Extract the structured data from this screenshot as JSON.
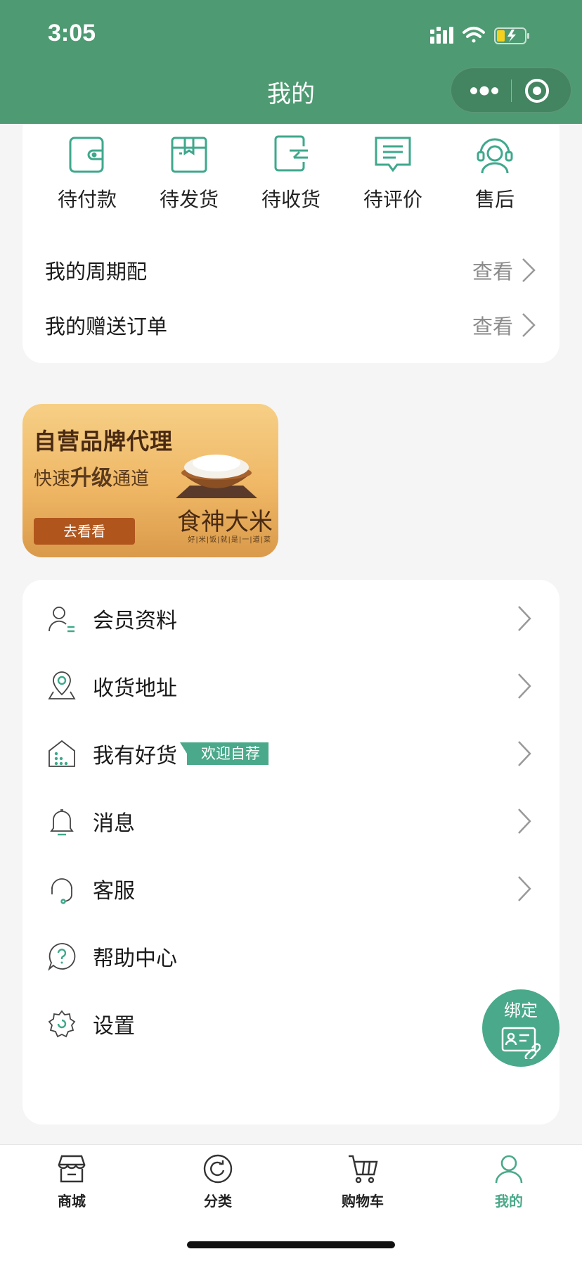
{
  "status_bar": {
    "time": "3:05"
  },
  "nav": {
    "title": "我的"
  },
  "orders": {
    "items": [
      {
        "label": "待付款",
        "icon": "wallet-icon"
      },
      {
        "label": "待发货",
        "icon": "box-icon"
      },
      {
        "label": "待收货",
        "icon": "receive-icon"
      },
      {
        "label": "待评价",
        "icon": "comment-icon"
      },
      {
        "label": "售后",
        "icon": "headset-icon"
      }
    ],
    "links": [
      {
        "title": "我的周期配",
        "action": "查看"
      },
      {
        "title": "我的赠送订单",
        "action": "查看"
      }
    ]
  },
  "banner": {
    "title": "自营品牌代理",
    "subtitle_pre": "快速",
    "subtitle_bold": "升级",
    "subtitle_post": "通道",
    "button": "去看看",
    "brand": "食神大米",
    "tiny": "好|米|饭|就|是|一|道|菜"
  },
  "menu": {
    "items": [
      {
        "label": "会员资料",
        "icon": "member-profile-icon"
      },
      {
        "label": "收货地址",
        "icon": "location-icon"
      },
      {
        "label": "我有好货",
        "icon": "house-icon",
        "tag": "欢迎自荐"
      },
      {
        "label": "消息",
        "icon": "bell-icon"
      },
      {
        "label": "客服",
        "icon": "customer-service-icon"
      },
      {
        "label": "帮助中心",
        "icon": "help-icon"
      },
      {
        "label": "设置",
        "icon": "settings-icon"
      }
    ]
  },
  "float_button": {
    "label": "绑定"
  },
  "tabbar": {
    "items": [
      {
        "label": "商城",
        "icon": "store-icon"
      },
      {
        "label": "分类",
        "icon": "category-icon"
      },
      {
        "label": "购物车",
        "icon": "cart-icon"
      },
      {
        "label": "我的",
        "icon": "user-icon",
        "active": true
      }
    ]
  },
  "colors": {
    "brand_green": "#4e9a72",
    "accent": "#4aa98a"
  }
}
